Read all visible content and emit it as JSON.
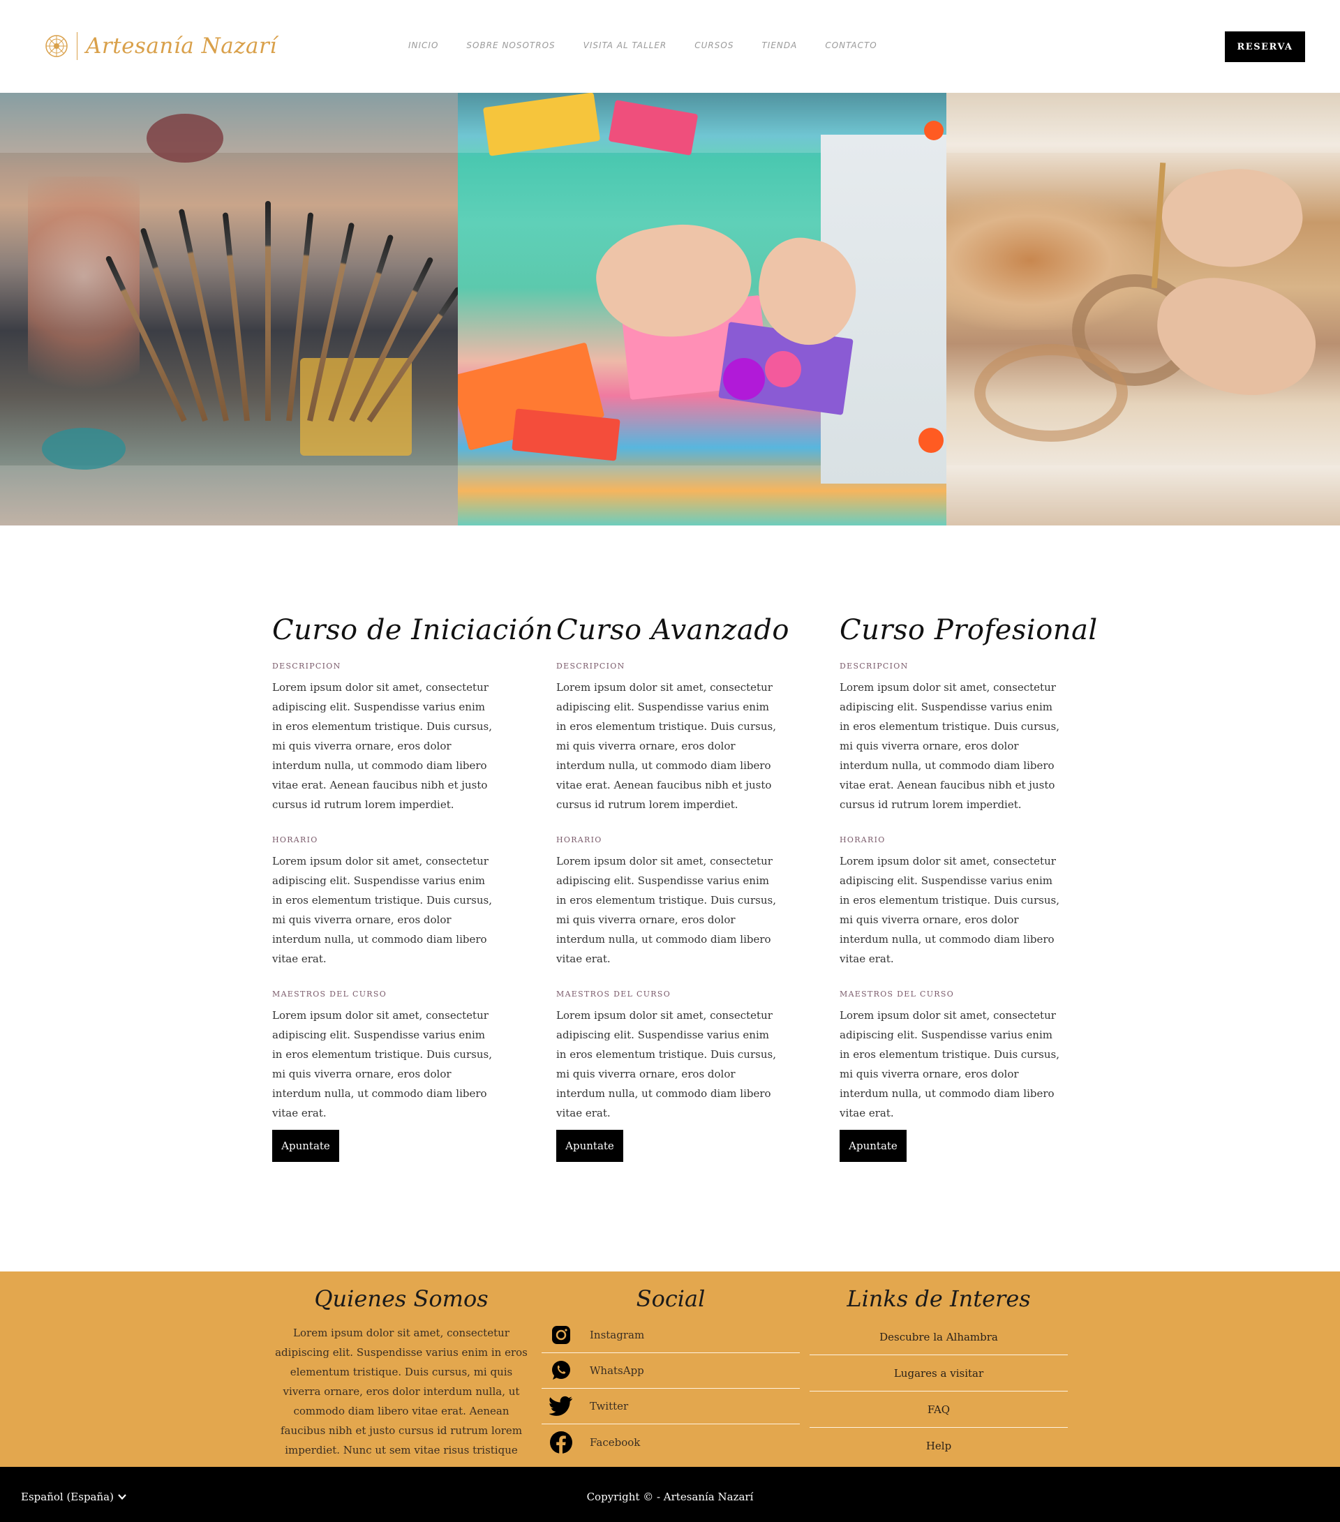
{
  "header": {
    "logo_text": "Artesanía Nazarí",
    "nav": [
      "INICIO",
      "SOBRE NOSOTROS",
      "VISITA AL TALLER",
      "CURSOS",
      "TIENDA",
      "CONTACTO"
    ],
    "reserva_label": "RESERVA"
  },
  "colors": {
    "accent": "#e3a74e",
    "logo": "#d9a04a",
    "button": "#000000"
  },
  "courses": [
    {
      "title": "Curso de Iniciación",
      "descripcion_label": "DESCRIPCION",
      "descripcion": "Lorem ipsum dolor sit amet, consectetur adipiscing elit. Suspendisse varius enim in eros elementum tristique. Duis cursus, mi quis viverra ornare, eros dolor interdum nulla, ut commodo diam libero vitae erat. Aenean faucibus nibh et justo cursus id rutrum lorem imperdiet.",
      "horario_label": "HORARIO",
      "horario": "Lorem ipsum dolor sit amet, consectetur adipiscing elit. Suspendisse varius enim in eros elementum tristique. Duis cursus, mi quis viverra ornare, eros dolor interdum nulla, ut commodo diam libero vitae erat.",
      "maestros_label": "MAESTROS DEL CURSO",
      "maestros": "Lorem ipsum dolor sit amet, consectetur adipiscing elit. Suspendisse varius enim in eros elementum tristique. Duis cursus, mi quis viverra ornare, eros dolor interdum nulla, ut commodo diam libero vitae erat.",
      "button": "Apuntate"
    },
    {
      "title": "Curso Avanzado",
      "descripcion_label": "DESCRIPCION",
      "descripcion": "Lorem ipsum dolor sit amet, consectetur adipiscing elit. Suspendisse varius enim in eros elementum tristique. Duis cursus, mi quis viverra ornare, eros dolor interdum nulla, ut commodo diam libero vitae erat. Aenean faucibus nibh et justo cursus id rutrum lorem imperdiet.",
      "horario_label": "HORARIO",
      "horario": "Lorem ipsum dolor sit amet, consectetur adipiscing elit. Suspendisse varius enim in eros elementum tristique. Duis cursus, mi quis viverra ornare, eros dolor interdum nulla, ut commodo diam libero vitae erat.",
      "maestros_label": "MAESTROS DEL CURSO",
      "maestros": "Lorem ipsum dolor sit amet, consectetur adipiscing elit. Suspendisse varius enim in eros elementum tristique. Duis cursus, mi quis viverra ornare, eros dolor interdum nulla, ut commodo diam libero vitae erat.",
      "button": "Apuntate"
    },
    {
      "title": "Curso Profesional",
      "descripcion_label": "DESCRIPCION",
      "descripcion": "Lorem ipsum dolor sit amet, consectetur adipiscing elit. Suspendisse varius enim in eros elementum tristique. Duis cursus, mi quis viverra ornare, eros dolor interdum nulla, ut commodo diam libero vitae erat. Aenean faucibus nibh et justo cursus id rutrum lorem imperdiet.",
      "horario_label": "HORARIO",
      "horario": "Lorem ipsum dolor sit amet, consectetur adipiscing elit. Suspendisse varius enim in eros elementum tristique. Duis cursus, mi quis viverra ornare, eros dolor interdum nulla, ut commodo diam libero vitae erat.",
      "maestros_label": "MAESTROS DEL CURSO",
      "maestros": "Lorem ipsum dolor sit amet, consectetur adipiscing elit. Suspendisse varius enim in eros elementum tristique. Duis cursus, mi quis viverra ornare, eros dolor interdum nulla, ut commodo diam libero vitae erat.",
      "button": "Apuntate"
    }
  ],
  "footer": {
    "quienes_title": "Quienes Somos",
    "quienes_text": "Lorem ipsum dolor sit amet, consectetur adipiscing elit. Suspendisse varius enim in eros elementum tristique. Duis cursus, mi quis viverra ornare, eros dolor interdum nulla, ut commodo diam libero vitae erat. Aenean faucibus nibh et justo cursus id rutrum lorem imperdiet. Nunc ut sem vitae risus tristique posuere.",
    "social_title": "Social",
    "social": [
      {
        "label": "Instagram",
        "icon": "instagram-icon"
      },
      {
        "label": "WhatsApp",
        "icon": "whatsapp-icon"
      },
      {
        "label": "Twitter",
        "icon": "twitter-icon"
      },
      {
        "label": "Facebook",
        "icon": "facebook-icon"
      }
    ],
    "links_title": "Links de Interes",
    "links": [
      "Descubre la Alhambra",
      "Lugares a visitar",
      "FAQ",
      "Help"
    ]
  },
  "bottom": {
    "language": "Español (España)",
    "copyright": "Copyright © - Artesanía Nazarí"
  }
}
